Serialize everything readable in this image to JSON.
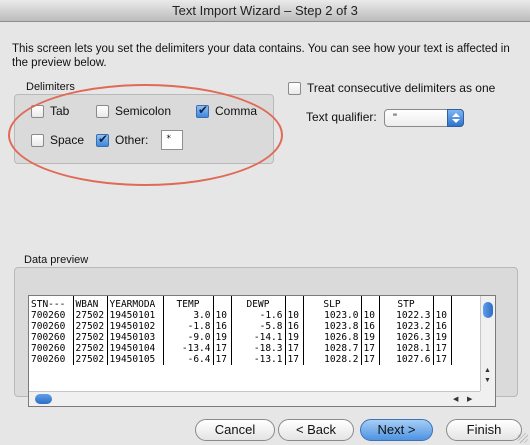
{
  "window": {
    "title": "Text Import Wizard – Step 2 of 3"
  },
  "intro": "This screen lets you set the delimiters your data contains.  You can see how your text is affected in the preview below.",
  "delimiters": {
    "title": "Delimiters",
    "tab": {
      "label": "Tab",
      "checked": false
    },
    "semicolon": {
      "label": "Semicolon",
      "checked": false
    },
    "comma": {
      "label": "Comma",
      "checked": true
    },
    "space": {
      "label": "Space",
      "checked": false
    },
    "other": {
      "label": "Other:",
      "checked": true,
      "value": "*"
    }
  },
  "consecutive": {
    "label": "Treat consecutive delimiters as one",
    "checked": false
  },
  "qualifier": {
    "label": "Text qualifier:",
    "value": "\""
  },
  "preview": {
    "title": "Data preview",
    "rows": [
      [
        "STN---",
        "WBAN",
        "YEARMODA",
        "TEMP",
        "",
        "DEWP",
        "",
        "SLP",
        "",
        "STP",
        ""
      ],
      [
        "700260",
        "27502",
        "19450101",
        "3.0",
        "10",
        "-1.6",
        "10",
        "1023.0",
        "10",
        "1022.3",
        "10"
      ],
      [
        "700260",
        "27502",
        "19450102",
        "-1.8",
        "16",
        "-5.8",
        "16",
        "1023.8",
        "16",
        "1023.2",
        "16"
      ],
      [
        "700260",
        "27502",
        "19450103",
        "-9.0",
        "19",
        "-14.1",
        "19",
        "1026.8",
        "19",
        "1026.3",
        "19"
      ],
      [
        "700260",
        "27502",
        "19450104",
        "-13.4",
        "17",
        "-18.3",
        "17",
        "1028.7",
        "17",
        "1028.1",
        "17"
      ],
      [
        "700260",
        "27502",
        "19450105",
        "-6.4",
        "17",
        "-13.1",
        "17",
        "1028.2",
        "17",
        "1027.6",
        "17"
      ]
    ]
  },
  "buttons": {
    "cancel": "Cancel",
    "back": "< Back",
    "next": "Next >",
    "finish": "Finish"
  },
  "colors": {
    "annotation_ellipse": "#e06a55",
    "default_button": "#4f93e2"
  }
}
